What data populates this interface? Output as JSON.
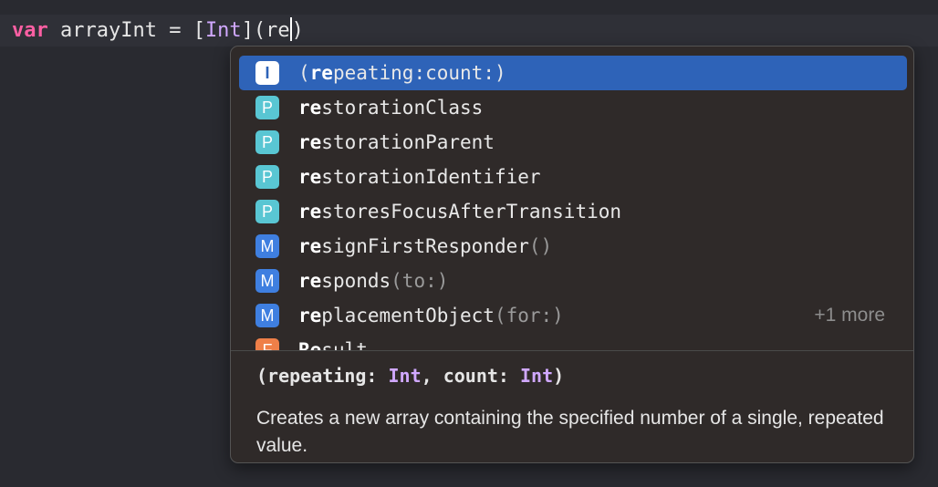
{
  "code_line": {
    "keyword": "var",
    "var_name": " arrayInt = [",
    "type_name": "Int",
    "after_type": "](re",
    "trailing": ")"
  },
  "completions": [
    {
      "badge": "I",
      "match": "re",
      "prefix": "(",
      "rest": "peating:count:)",
      "dim": "",
      "more": "",
      "selected": true
    },
    {
      "badge": "P",
      "match": "re",
      "prefix": "",
      "rest": "storationClass",
      "dim": "",
      "more": ""
    },
    {
      "badge": "P",
      "match": "re",
      "prefix": "",
      "rest": "storationParent",
      "dim": "",
      "more": ""
    },
    {
      "badge": "P",
      "match": "re",
      "prefix": "",
      "rest": "storationIdentifier",
      "dim": "",
      "more": ""
    },
    {
      "badge": "P",
      "match": "re",
      "prefix": "",
      "rest": "storesFocusAfterTransition",
      "dim": "",
      "more": ""
    },
    {
      "badge": "M",
      "match": "re",
      "prefix": "",
      "rest": "signFirstResponder",
      "dim": "()",
      "more": ""
    },
    {
      "badge": "M",
      "match": "re",
      "prefix": "",
      "rest": "sponds",
      "dim": "(to:)",
      "more": ""
    },
    {
      "badge": "M",
      "match": "re",
      "prefix": "",
      "rest": "placementObject",
      "dim": "(for:)",
      "more": "+1 more"
    },
    {
      "badge": "F",
      "match": "Re",
      "prefix": "",
      "rest": "sult",
      "dim": "",
      "more": ""
    }
  ],
  "detail": {
    "sig_open": "(repeating: ",
    "sig_type1": "Int",
    "sig_mid": ", count: ",
    "sig_type2": "Int",
    "sig_close": ")",
    "description": "Creates a new array containing the specified number of a single, repeated value."
  },
  "colors": {
    "selection": "#2e63b8",
    "badge_property": "#59c6d3",
    "badge_method": "#3f7fe0",
    "badge_function": "#ef7f48",
    "keyword": "#fc5fa3",
    "type": "#d0a8ff"
  }
}
